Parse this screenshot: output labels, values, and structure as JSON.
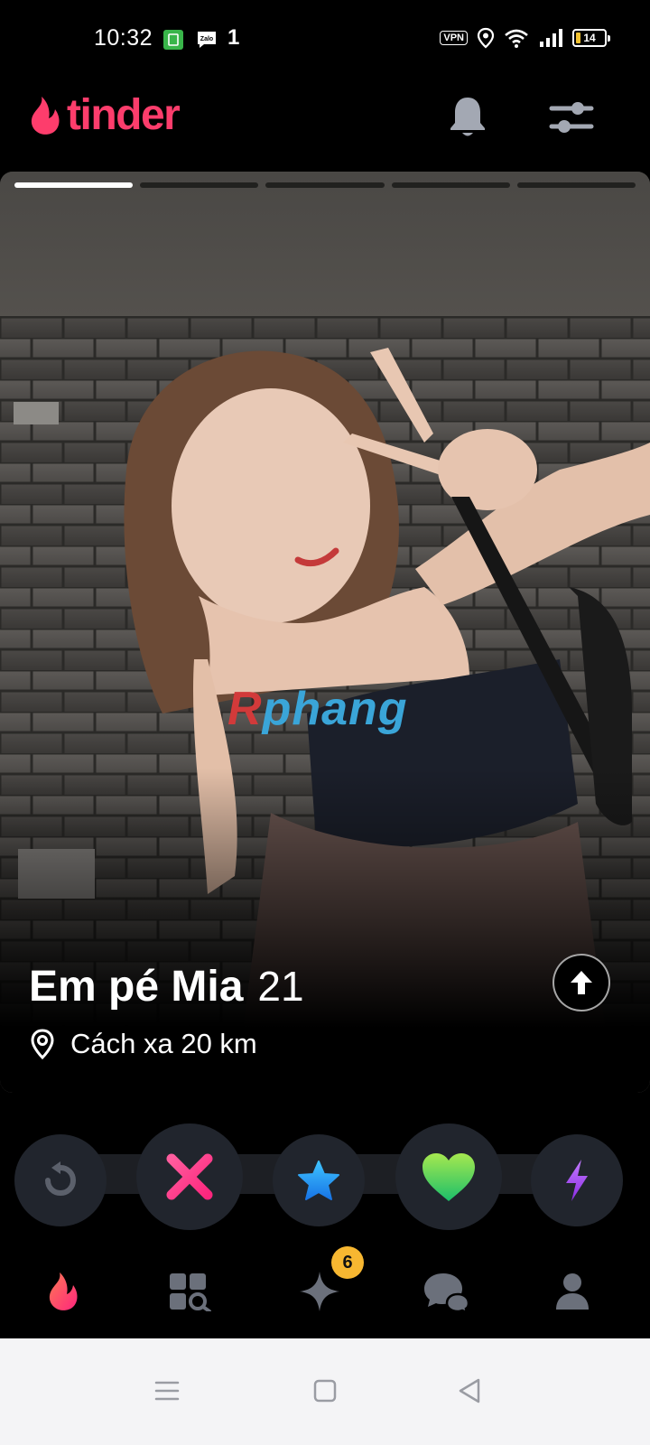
{
  "status_bar": {
    "time": "10:32",
    "notification_indicator": "1",
    "network_indicator": "VPN",
    "battery_level": "14"
  },
  "header": {
    "app_name": "tinder"
  },
  "profile": {
    "name": "Em pé Mia",
    "age": "21",
    "distance": "Cách xa 20 km",
    "photo_count": 5,
    "current_photo": 1,
    "watermark_first": "R",
    "watermark_rest": "phang"
  },
  "actions": [
    "rewind-button",
    "nope-button",
    "super-like-button",
    "like-button",
    "boost-button"
  ],
  "nav": {
    "likes_badge": "6",
    "active_tab": "discover"
  },
  "colors": {
    "brand": "#fd3d6c",
    "nope": "#fd267d",
    "super_like": "#1e90ff",
    "like": "#63d42a",
    "boost": "#a445f2",
    "badge": "#f7b731"
  }
}
